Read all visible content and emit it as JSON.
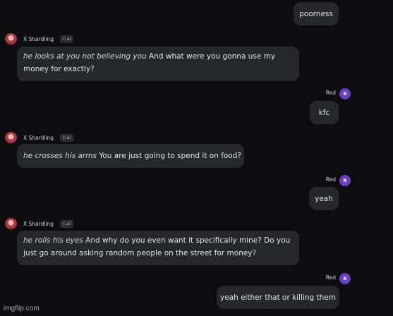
{
  "bot": {
    "name": "X Shardling",
    "badge": "c.ai"
  },
  "user": {
    "name": "Red",
    "avatar_initial": "R"
  },
  "messages": [
    {
      "role": "user",
      "text": "poorness"
    },
    {
      "role": "bot",
      "action": "he looks at you not believing you",
      "text": " And what were you gonna use my money for exactly?"
    },
    {
      "role": "user",
      "text": "kfc"
    },
    {
      "role": "bot",
      "action": "he crosses his arms",
      "text": " You are just going to spend it on food?"
    },
    {
      "role": "user",
      "text": "yeah"
    },
    {
      "role": "bot",
      "action": "he rolls his eyes",
      "text": " And why do you even want it specifically mine? Do you just go around asking random people on the street for money?"
    },
    {
      "role": "user",
      "text": "yeah either that or killing them"
    }
  ],
  "watermark": "imgflip.com",
  "colors": {
    "background": "#0d0d0f",
    "bubble": "#26272b",
    "user_avatar": "#6b3fc4",
    "badge": "#2c2d31"
  },
  "icons": {
    "bot_avatar": "character-avatar",
    "user_avatar": "initial-circle-avatar"
  }
}
